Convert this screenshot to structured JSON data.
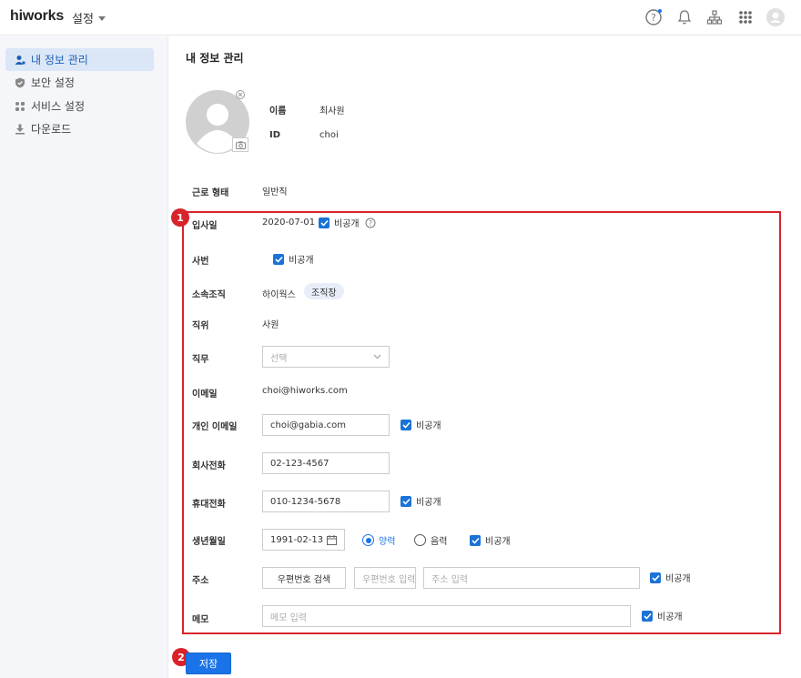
{
  "header": {
    "logo": "hiworks",
    "menu_label": "설정",
    "icons": [
      "help-icon",
      "bell-icon",
      "org-chart-icon",
      "apps-grid-icon",
      "user-avatar-icon"
    ]
  },
  "sidebar": {
    "items": [
      {
        "label": "내 정보 관리",
        "icon": "person-icon",
        "active": true
      },
      {
        "label": "보안 설정",
        "icon": "shield-icon",
        "active": false
      },
      {
        "label": "서비스 설정",
        "icon": "services-icon",
        "active": false
      },
      {
        "label": "다운로드",
        "icon": "download-icon",
        "active": false
      }
    ]
  },
  "main": {
    "title": "내 정보 관리",
    "profile": {
      "name_label": "이름",
      "name_value": "최사원",
      "id_label": "ID",
      "id_value": "choi"
    },
    "employment_label": "근로 형태",
    "employment_value": "일반직",
    "badges": [
      "1",
      "2"
    ],
    "form": {
      "hire_date_label": "입사일",
      "hire_date_value": "2020-07-01",
      "private_label": "비공개",
      "emp_no_label": "사번",
      "org_label": "소속조직",
      "org_value": "하이웍스",
      "org_role": "조직장",
      "position_label": "직위",
      "position_value": "사원",
      "duty_label": "직무",
      "duty_placeholder": "선택",
      "email_label": "이메일",
      "email_value": "choi@hiworks.com",
      "personal_email_label": "개인 이메일",
      "personal_email_value": "choi@gabia.com",
      "office_phone_label": "회사전화",
      "office_phone_value": "02-123-4567",
      "mobile_label": "휴대전화",
      "mobile_value": "010-1234-5678",
      "birth_label": "생년월일",
      "birth_value": "1991-02-13",
      "solar_label": "양력",
      "lunar_label": "음력",
      "address_label": "주소",
      "zip_search_label": "우편번호 검색",
      "zip_placeholder": "우편번호 입력",
      "address_placeholder": "주소 입력",
      "memo_label": "메모",
      "memo_placeholder": "메모 입력"
    },
    "save_label": "저장"
  },
  "colors": {
    "accent": "#1a73e8",
    "highlight_frame": "#d8232a"
  }
}
